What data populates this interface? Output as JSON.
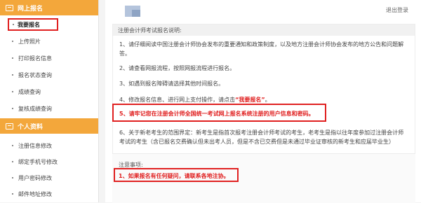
{
  "sidebar": {
    "section1": {
      "title": "网上报名",
      "icon": "monitor-icon"
    },
    "items1": [
      {
        "label": "我要报名"
      },
      {
        "label": "上传照片"
      },
      {
        "label": "打印报名信息"
      },
      {
        "label": "报名状态查询"
      },
      {
        "label": "成绩查询"
      },
      {
        "label": "复核成绩查询"
      }
    ],
    "section2": {
      "title": "个人资料",
      "icon": "id-card-icon"
    },
    "items2": [
      {
        "label": "注册信息修改"
      },
      {
        "label": "绑定手机号修改"
      },
      {
        "label": "用户密码修改"
      },
      {
        "label": "邮件地址修改"
      }
    ]
  },
  "header": {
    "logout_label": "退出登录"
  },
  "instructions": {
    "title": "注册会计师考试报名说明:",
    "item1": "1、请仔细阅读中国注册会计师协会发布的重要通知和政策制度，以及地方注册会计师协会发布的地方公告和问题解答。",
    "item2": "2、请查看网报流程，按照网报流程进行报名。",
    "item3": "3、如遇到报名障碍请选择其他时间报名。",
    "item4_pre": "4、修改报名信息、进行网上支付操作，请点击",
    "item4_link": "“我要报名”",
    "item4_post": "。",
    "item5": "5、请牢记您在注册会计师全国统一考试网上报名系统注册的用户信息和密码。",
    "item6": "6、关于新老考生的范围界定：新考生是指首次报考注册会计师考试的考生，老考生是指以往年度参加过注册会计师考试的考生（含已报名交费确认但未出考人员，但是不含已交费但是未通过毕业证审核的新考生和应届毕业生）"
  },
  "notice": {
    "title": "注意事项:",
    "item1": "1、如果报名有任何疑问，请联系各地注协。"
  },
  "colors": {
    "accent": "#f3a73b",
    "highlight": "#e02020"
  }
}
